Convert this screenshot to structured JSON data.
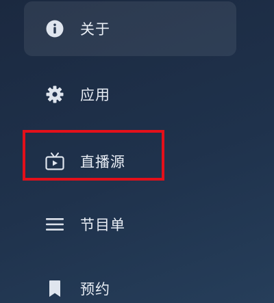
{
  "menu": {
    "items": [
      {
        "label": "关于",
        "icon": "info-icon",
        "selected": true
      },
      {
        "label": "应用",
        "icon": "gear-icon",
        "selected": false
      },
      {
        "label": "直播源",
        "icon": "tv-icon",
        "selected": false
      },
      {
        "label": "节目单",
        "icon": "list-icon",
        "selected": false
      },
      {
        "label": "预约",
        "icon": "bookmark-icon",
        "selected": false
      }
    ]
  },
  "colors": {
    "icon": "#dfe5ee",
    "highlight_border": "#e3101a"
  }
}
